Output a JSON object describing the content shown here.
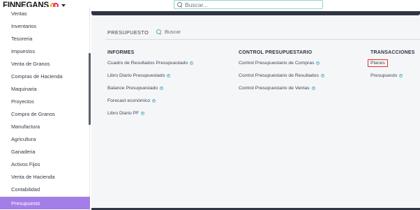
{
  "app": {
    "brand": "FINNEGANS",
    "search_placeholder": "Buscar..."
  },
  "sidebar": {
    "items": [
      {
        "label": "Ventas"
      },
      {
        "label": "Inventarios"
      },
      {
        "label": "Tesoreria"
      },
      {
        "label": "Impuestos"
      },
      {
        "label": "Venta de Granos"
      },
      {
        "label": "Compras de Hacienda"
      },
      {
        "label": "Maquinaria"
      },
      {
        "label": "Proyectos"
      },
      {
        "label": "Compra de Granos"
      },
      {
        "label": "Manufactura"
      },
      {
        "label": "Agricultura"
      },
      {
        "label": "Ganaderia"
      },
      {
        "label": "Activos Fijos"
      },
      {
        "label": "Venta de Hacienda"
      },
      {
        "label": "Contabilidad"
      },
      {
        "label": "Presupuesto",
        "active": true
      }
    ]
  },
  "main": {
    "section_title": "PRESUPUESTO",
    "search_label": "Buscar",
    "columns": [
      {
        "heading": "INFORMES",
        "links": [
          "Cuadro de Resultados Presupuestado",
          "Libro Diario Presupuestado",
          "Balance Presupuestado",
          "Forecast económico",
          "Libro Diario PF"
        ]
      },
      {
        "heading": "CONTROL PRESUPUESTARIO",
        "links": [
          "Control Presupuestario de Compras",
          "Control Presupuestario de Resultados",
          "Control Presupuestario de Ventas"
        ]
      },
      {
        "heading": "TRANSACCIONES",
        "links": [
          "Planes",
          "Presupuesto"
        ]
      }
    ]
  },
  "colors": {
    "active_item": "#a47ee8",
    "dark_strip": "#2f3542",
    "highlight_box": "#e0342a",
    "info_icon": "#6ab4c8"
  }
}
